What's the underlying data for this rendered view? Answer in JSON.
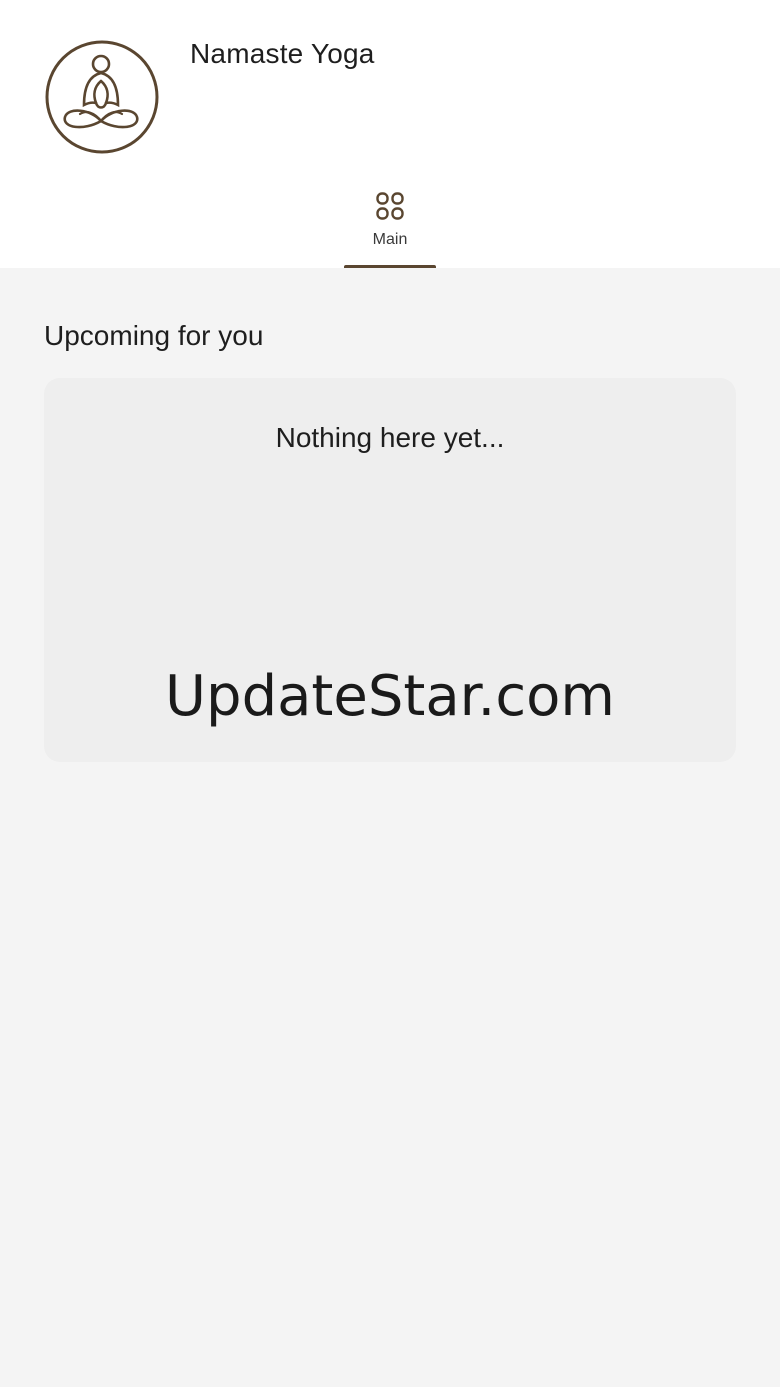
{
  "app": {
    "title": "Namaste Yoga",
    "logo_icon": "meditation-pose-icon",
    "logo_color": "#5a4630"
  },
  "tabs": [
    {
      "label": "Main",
      "icon": "grid-icon",
      "active": true
    }
  ],
  "upcoming": {
    "section_title": "Upcoming for you",
    "empty_message": "Nothing here yet..."
  },
  "watermark": {
    "text": "UpdateStar.com"
  },
  "colors": {
    "accent": "#5a4630",
    "background": "#f4f4f4",
    "header_background": "#ffffff",
    "card_background": "#eeeeee"
  }
}
